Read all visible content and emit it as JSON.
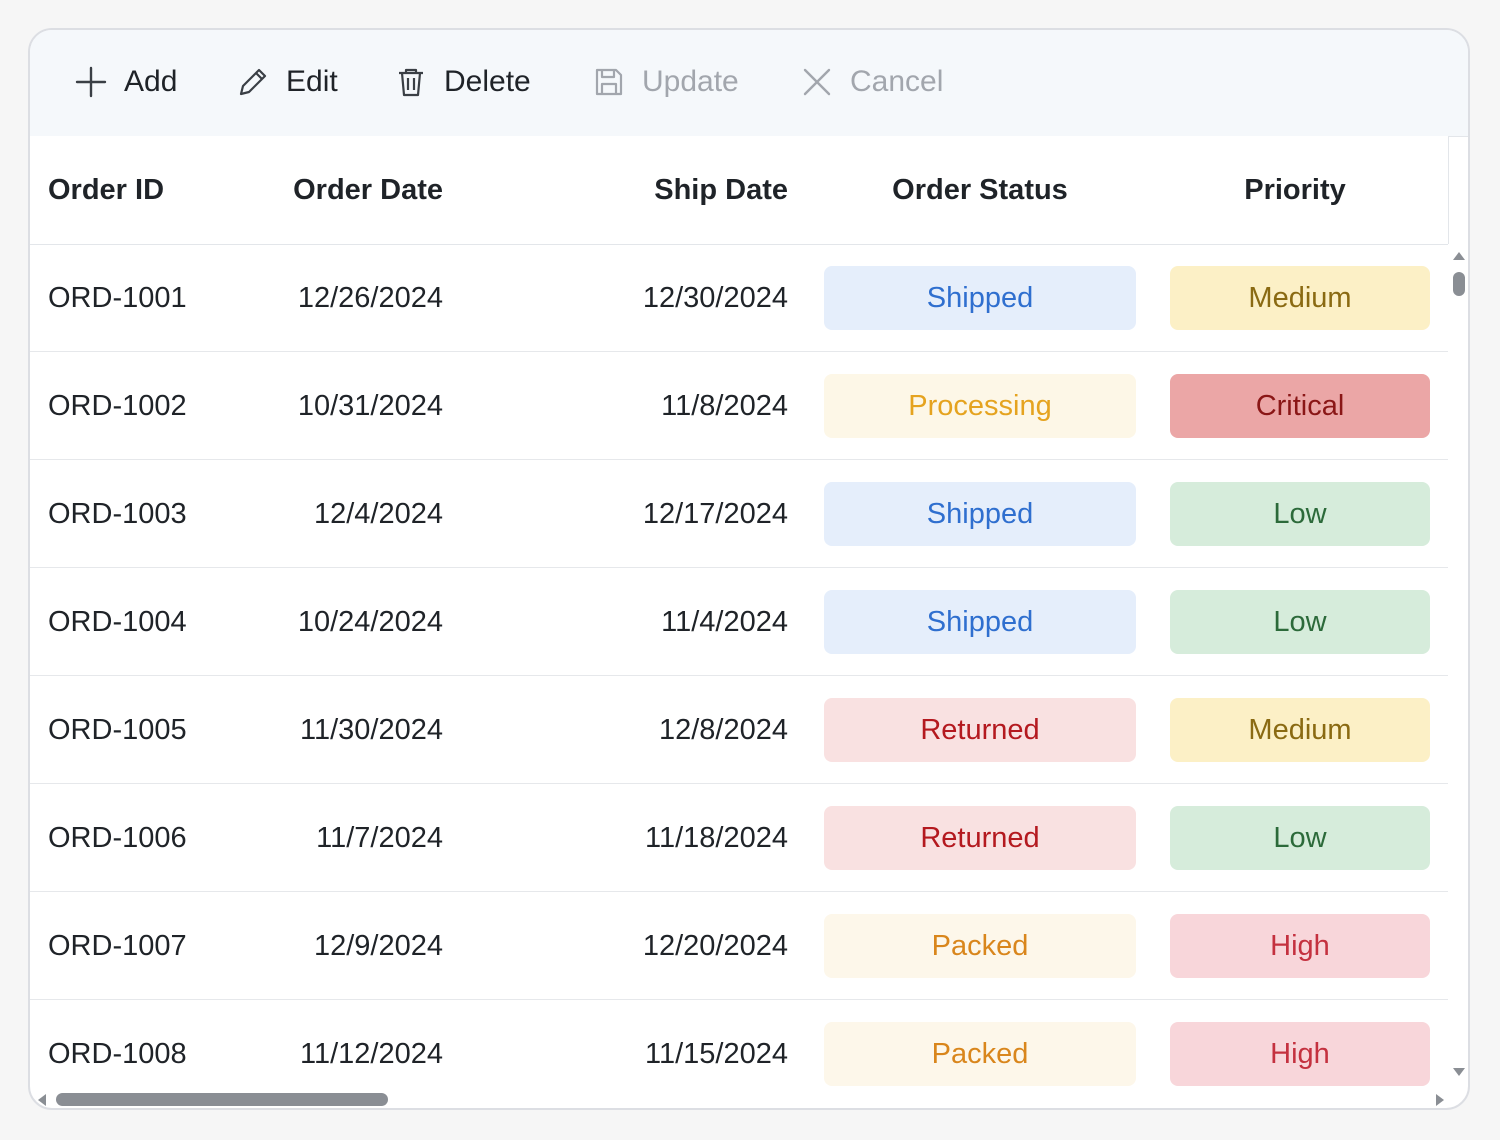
{
  "toolbar": {
    "add": {
      "label": "Add",
      "icon": "plus-icon",
      "enabled": true
    },
    "edit": {
      "label": "Edit",
      "icon": "pencil-icon",
      "enabled": true
    },
    "delete": {
      "label": "Delete",
      "icon": "trash-icon",
      "enabled": true
    },
    "update": {
      "label": "Update",
      "icon": "save-icon",
      "enabled": false
    },
    "cancel": {
      "label": "Cancel",
      "icon": "close-icon",
      "enabled": false
    }
  },
  "columns": {
    "order_id": "Order ID",
    "order_date": "Order Date",
    "ship_date": "Ship Date",
    "order_status": "Order Status",
    "priority": "Priority"
  },
  "status_styles": {
    "Shipped": {
      "bg": "#e5eefb",
      "fg": "#2f6fcf"
    },
    "Processing": {
      "bg": "#fdf7e7",
      "fg": "#e5a31f"
    },
    "Returned": {
      "bg": "#f9e1e1",
      "fg": "#b4191f"
    },
    "Packed": {
      "bg": "#fdf7ea",
      "fg": "#d9861c"
    }
  },
  "priority_styles": {
    "Medium": {
      "bg": "#fcf0c6",
      "fg": "#8a6a12"
    },
    "Critical": {
      "bg": "#eba6a6",
      "fg": "#8a1616"
    },
    "Low": {
      "bg": "#d6ecdb",
      "fg": "#2c6a3a"
    },
    "High": {
      "bg": "#f8d6da",
      "fg": "#c4313f"
    }
  },
  "rows": [
    {
      "order_id": "ORD-1001",
      "order_date": "12/26/2024",
      "ship_date": "12/30/2024",
      "status": "Shipped",
      "priority": "Medium"
    },
    {
      "order_id": "ORD-1002",
      "order_date": "10/31/2024",
      "ship_date": "11/8/2024",
      "status": "Processing",
      "priority": "Critical"
    },
    {
      "order_id": "ORD-1003",
      "order_date": "12/4/2024",
      "ship_date": "12/17/2024",
      "status": "Shipped",
      "priority": "Low"
    },
    {
      "order_id": "ORD-1004",
      "order_date": "10/24/2024",
      "ship_date": "11/4/2024",
      "status": "Shipped",
      "priority": "Low"
    },
    {
      "order_id": "ORD-1005",
      "order_date": "11/30/2024",
      "ship_date": "12/8/2024",
      "status": "Returned",
      "priority": "Medium"
    },
    {
      "order_id": "ORD-1006",
      "order_date": "11/7/2024",
      "ship_date": "11/18/2024",
      "status": "Returned",
      "priority": "Low"
    },
    {
      "order_id": "ORD-1007",
      "order_date": "12/9/2024",
      "ship_date": "12/20/2024",
      "status": "Packed",
      "priority": "High"
    },
    {
      "order_id": "ORD-1008",
      "order_date": "11/12/2024",
      "ship_date": "11/15/2024",
      "status": "Packed",
      "priority": "High"
    }
  ]
}
